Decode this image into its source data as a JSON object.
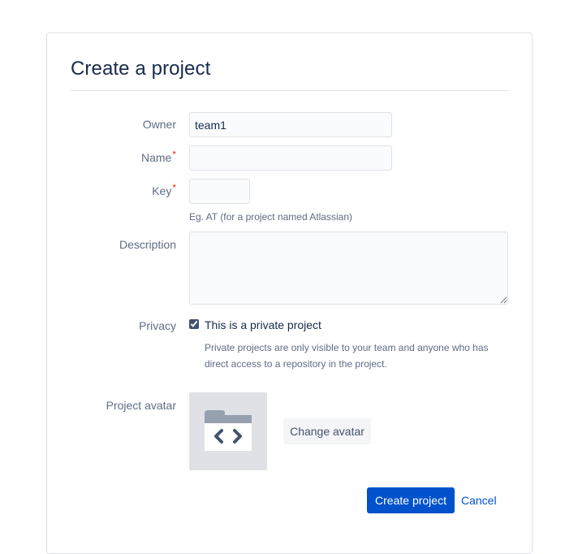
{
  "form": {
    "title": "Create a project",
    "owner": {
      "label": "Owner",
      "value": "team1"
    },
    "name": {
      "label": "Name",
      "required_mark": "*",
      "value": ""
    },
    "key": {
      "label": "Key",
      "required_mark": "*",
      "value": "",
      "hint": "Eg. AT (for a project named Atlassian)"
    },
    "description": {
      "label": "Description",
      "value": ""
    },
    "privacy": {
      "label": "Privacy",
      "checked": true,
      "checkbox_label": "This is a private project",
      "description": "Private projects are only visible to your team and anyone who has direct access to a repository in the project."
    },
    "avatar": {
      "label": "Project avatar",
      "icon": "folder-code-icon",
      "change_label": "Change avatar"
    },
    "actions": {
      "submit_label": "Create project",
      "cancel_label": "Cancel"
    }
  },
  "colors": {
    "primary": "#0052cc",
    "required": "#de350b",
    "muted_text": "#5e6c84",
    "avatar_bg": "#dfe1e6"
  }
}
